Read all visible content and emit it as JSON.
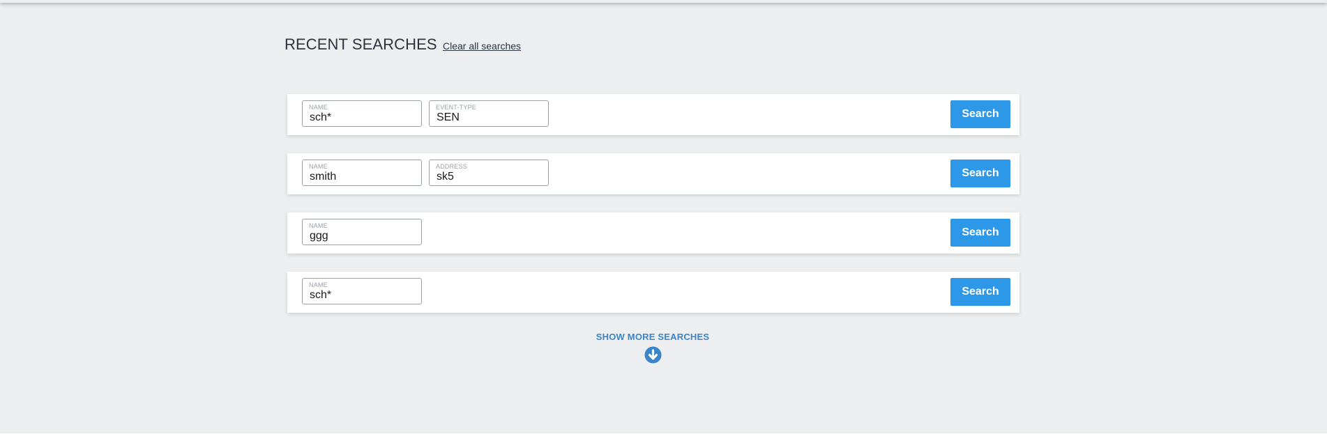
{
  "header": {
    "title": "RECENT SEARCHES",
    "clear_label": "Clear all searches"
  },
  "searches": [
    {
      "fields": [
        {
          "label": "NAME",
          "value": "sch*"
        },
        {
          "label": "EVENT-TYPE",
          "value": "SEN"
        }
      ],
      "button_label": "Search"
    },
    {
      "fields": [
        {
          "label": "NAME",
          "value": "smith"
        },
        {
          "label": "ADDRESS",
          "value": "sk5"
        }
      ],
      "button_label": "Search"
    },
    {
      "fields": [
        {
          "label": "NAME",
          "value": "ggg"
        }
      ],
      "button_label": "Search"
    },
    {
      "fields": [
        {
          "label": "NAME",
          "value": "sch*"
        }
      ],
      "button_label": "Search"
    }
  ],
  "show_more": {
    "label": "SHOW MORE SEARCHES",
    "icon": "arrow-circle-down-icon"
  },
  "colors": {
    "background": "#eceef0",
    "accent_button": "#2e98e8",
    "link_blue": "#3a85c9",
    "title_text": "#2a3440"
  }
}
